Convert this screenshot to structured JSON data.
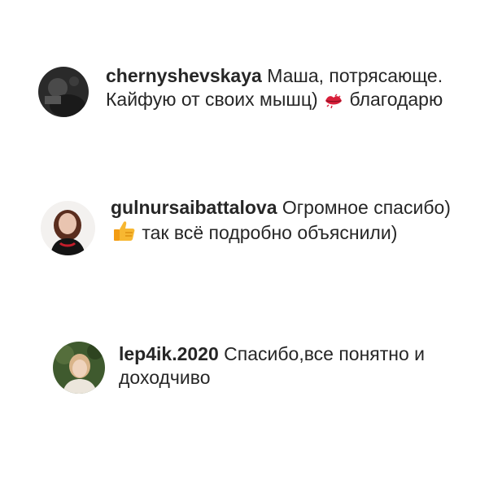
{
  "comments": [
    {
      "username": "chernyshevskaya",
      "text_before_emoji": "Маша, потрясающе. Кайфую от своих мышц)",
      "emoji": "kiss-lips-icon",
      "text_after_emoji": "благодарю"
    },
    {
      "username": "gulnursaibattalova",
      "text_before_emoji": "Огромное спасибо)",
      "emoji": "thumbs-up-icon",
      "text_after_emoji": "так всё подробно объяснили)"
    },
    {
      "username": "lep4ik.2020",
      "text": "Спасибо,все понятно и доходчиво"
    }
  ]
}
